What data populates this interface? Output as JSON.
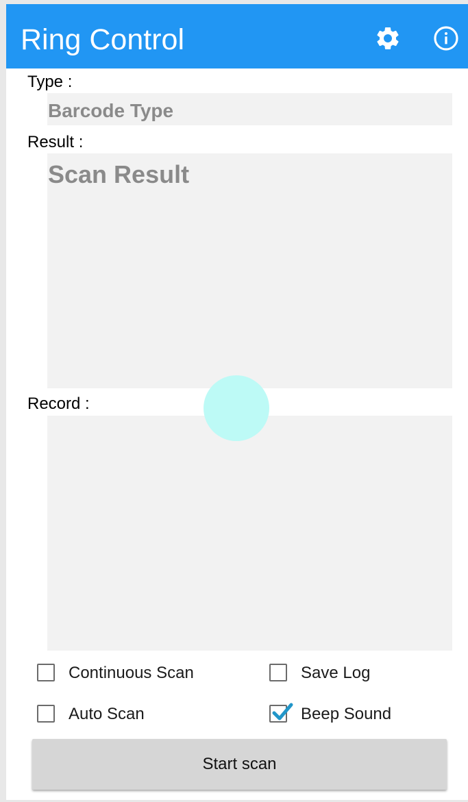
{
  "app": {
    "title": "Ring Control",
    "accent_color": "#2196f3"
  },
  "toolbar": {
    "settings_icon": "gear-icon",
    "info_icon": "info-icon"
  },
  "type": {
    "label": "Type :",
    "value": "Barcode Type"
  },
  "result": {
    "label": "Result :",
    "value": "Scan Result"
  },
  "record": {
    "label": "Record :",
    "value": ""
  },
  "options": {
    "continuous_scan": {
      "label": "Continuous Scan",
      "checked": false
    },
    "save_log": {
      "label": "Save Log",
      "checked": false
    },
    "auto_scan": {
      "label": "Auto Scan",
      "checked": false
    },
    "beep_sound": {
      "label": "Beep Sound",
      "checked": true,
      "check_color": "#2196c9"
    }
  },
  "actions": {
    "start_scan": "Start scan"
  }
}
